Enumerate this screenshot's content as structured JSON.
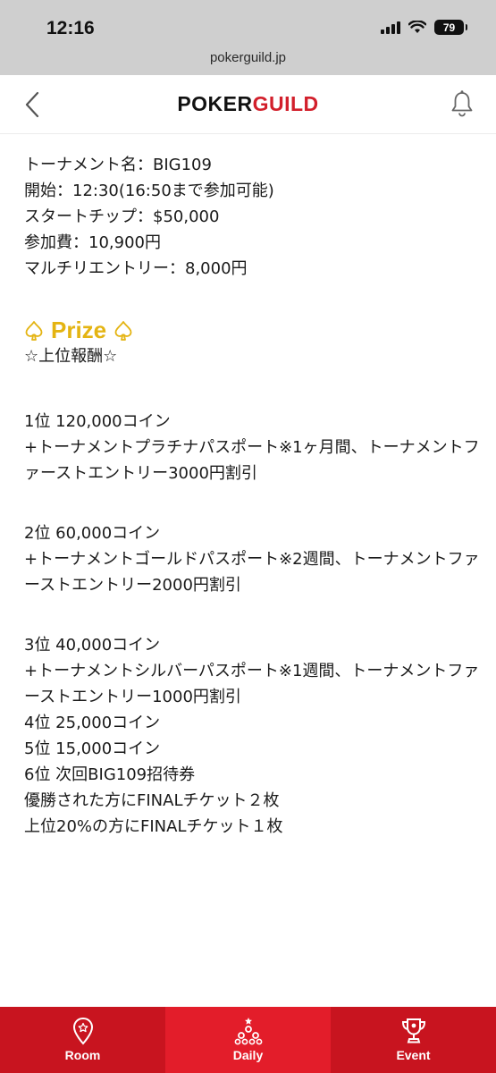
{
  "status_bar": {
    "time": "12:16",
    "battery": "79"
  },
  "browser": {
    "url": "pokerguild.jp"
  },
  "header": {
    "logo_part1": "POKER",
    "logo_part2": "GUILD"
  },
  "tournament": {
    "name_line": "トーナメント名：BIG109",
    "start_line": "開始：12:30(16:50まで参加可能)",
    "chip_line": "スタートチップ：$50,000",
    "fee_line": "参加費：10,900円",
    "reentry_line": "マルチリエントリー：8,000円"
  },
  "prize": {
    "heading": "Prize",
    "subheading": "☆上位報酬☆",
    "ranks": [
      {
        "line1": "1位 120,000コイン",
        "line2": "+トーナメントプラチナパスポート※1ヶ月間、トーナメントファーストエントリー3000円割引"
      },
      {
        "line1": "2位 60,000コイン",
        "line2": "+トーナメントゴールドパスポート※2週間、トーナメントファーストエントリー2000円割引"
      },
      {
        "line1": "3位 40,000コイン",
        "line2": "+トーナメントシルバーパスポート※1週間、トーナメントファーストエントリー1000円割引"
      },
      {
        "line1": "4位 25,000コイン"
      },
      {
        "line1": "5位 15,000コイン"
      },
      {
        "line1": "6位 次回BIG109招待券"
      }
    ],
    "note1": "優勝された方にFINALチケット２枚",
    "note2": "上位20%の方にFINALチケット１枚"
  },
  "tabs": [
    {
      "label": "Room",
      "icon": "location-pin-icon"
    },
    {
      "label": "Daily",
      "icon": "trophy-tree-icon"
    },
    {
      "label": "Event",
      "icon": "cup-icon"
    }
  ],
  "colors": {
    "accent_red": "#c8141f",
    "prize_gold": "#e4b412"
  }
}
